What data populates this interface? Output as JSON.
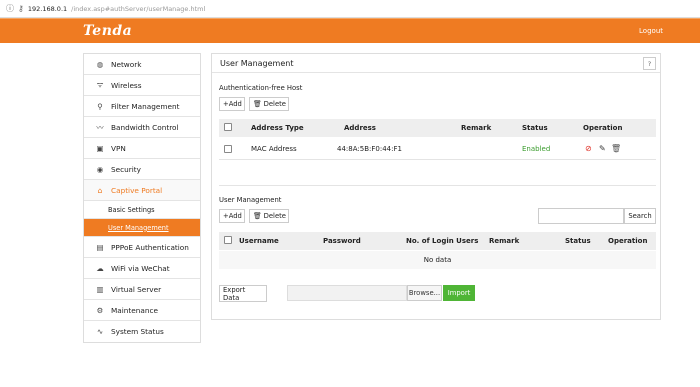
{
  "browser": {
    "host": "192.168.0.1",
    "path": "/index.asp#authServer/userManage.html"
  },
  "header": {
    "logo": "Tenda",
    "logout": "Logout"
  },
  "sidebar": {
    "items": [
      {
        "label": "Network",
        "icon": "globe-icon"
      },
      {
        "label": "Wireless",
        "icon": "wifi-icon"
      },
      {
        "label": "Filter Management",
        "icon": "filter-icon"
      },
      {
        "label": "Bandwidth Control",
        "icon": "bandwidth-icon"
      },
      {
        "label": "VPN",
        "icon": "vpn-icon"
      },
      {
        "label": "Security",
        "icon": "security-icon"
      },
      {
        "label": "Captive Portal",
        "icon": "portal-icon"
      }
    ],
    "sub_items": [
      {
        "label": "Basic Settings"
      },
      {
        "label": "User Management"
      }
    ],
    "items_after": [
      {
        "label": "PPPoE Authentication",
        "icon": "pppoe-icon"
      },
      {
        "label": "WiFi via WeChat",
        "icon": "wechat-icon"
      },
      {
        "label": "Virtual Server",
        "icon": "server-icon"
      },
      {
        "label": "Maintenance",
        "icon": "wrench-icon"
      },
      {
        "label": "System Status",
        "icon": "pulse-icon"
      }
    ]
  },
  "panel": {
    "title": "User Management",
    "help": "?",
    "auth_free": {
      "section_title": "Authentication-free Host",
      "add_label": "+Add",
      "delete_label": "Delete",
      "columns": [
        "Address Type",
        "Address",
        "Remark",
        "Status",
        "Operation"
      ],
      "rows": [
        {
          "type": "MAC Address",
          "address": "44:8A:5B:F0:44:F1",
          "remark": "",
          "status": "Enabled"
        }
      ]
    },
    "users": {
      "section_title": "User Management",
      "add_label": "+Add",
      "delete_label": "Delete",
      "search_label": "Search",
      "search_placeholder": "",
      "columns": [
        "Username",
        "Password",
        "No. of Login Users",
        "Remark",
        "Status",
        "Operation"
      ],
      "empty_text": "No data"
    },
    "export_label": "Export Data",
    "browse_label": "Browse...",
    "import_label": "Import"
  },
  "colors": {
    "accent": "#ef7b22",
    "enabled": "#3a9c2d",
    "import": "#4fb536"
  }
}
